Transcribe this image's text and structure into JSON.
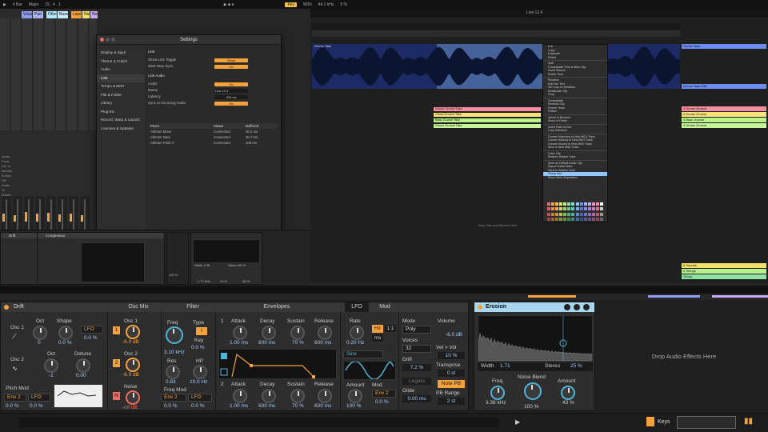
{
  "topbar": {
    "tempo": "4 Bar",
    "scale": "Major",
    "position": "15 . 4 . 1",
    "key_label": "Key",
    "midi_label": "MIDI",
    "sample_rate": "44.1 kHz",
    "cpu": "5 %"
  },
  "session": {
    "tracks": [
      {
        "name": "Vocal",
        "color": "#8f9cf2"
      },
      {
        "name": "Pad",
        "color": "#a9b2f5"
      },
      {
        "name": "Other",
        "color": "#b3e7ff"
      },
      {
        "name": "Bass",
        "color": "#c9ecff"
      },
      {
        "name": "Layers",
        "color": "#f6a23c"
      },
      {
        "name": "Note 1",
        "color": "#f2e16a"
      },
      {
        "name": "Note 2",
        "color": "#c9a8f5"
      }
    ],
    "io_text": [
      "Audio From",
      "Ext. In",
      "1/2",
      "Monitor",
      "In Auto Off",
      "Audio To",
      "Master"
    ]
  },
  "settings": {
    "title": "Settings",
    "nav": [
      {
        "label": "Display & Input",
        "active": false
      },
      {
        "label": "Theme & Colors",
        "active": false
      },
      {
        "label": "Audio",
        "active": false
      },
      {
        "label": "Link",
        "active": true
      },
      {
        "label": "Tempo & MIDI",
        "active": false
      },
      {
        "label": "File & Folder",
        "active": false
      },
      {
        "label": "Library",
        "active": false
      },
      {
        "label": "Plug-Ins",
        "active": false
      },
      {
        "label": "Record, Warp & Launch",
        "active": false
      },
      {
        "label": "Licenses & Updates",
        "active": false
      }
    ],
    "section_link": "Link",
    "show_link_toggle_label": "Show Link Toggle",
    "show_link_toggle_value": "Show",
    "start_stop_sync_label": "Start Stop Sync",
    "start_stop_sync_value": "On",
    "section_link_audio": "Link Audio",
    "audio_label": "Audio",
    "audio_value": "On",
    "name_label": "Name",
    "name_value": "Live 12.4",
    "latency_label": "Latency",
    "latency_value": "200 ms",
    "sync_label": "Sync to Incoming Audio",
    "sync_value": "On",
    "peers_headers": [
      "Peers",
      "Status",
      "Buffered"
    ],
    "peers": [
      {
        "name": "Ableton Move",
        "status": "Connected",
        "buffered": "30.2 ms"
      },
      {
        "name": "Ableton Note",
        "status": "Connected",
        "buffered": "30.7 ms"
      },
      {
        "name": "Ableton Push 3",
        "status": "Connected",
        "buffered": "109 ms"
      }
    ]
  },
  "arrangement": {
    "title": "Live 12.4",
    "ruler_ticks": [
      "65.1",
      "68.1",
      "72.1",
      "76.1",
      "80.1",
      "84.1",
      "88.1",
      "92.1",
      "96.1",
      "100.1",
      "104.1",
      "108.1",
      "112.1",
      "116.1",
      "120.1"
    ],
    "time_ticks": [
      "0:00",
      "0:10",
      "0:20",
      "0:30",
      "0:40",
      "0:50",
      "1:00",
      "1:10",
      "1:20",
      "1:30"
    ],
    "audio_clip_name": "Drums Take",
    "tracks_right": [
      {
        "name": "Drums Take",
        "color": "#6c8cf0"
      },
      {
        "name": "Drums Take Edit",
        "color": "#6c8cf0"
      },
      {
        "name": "1 Drums Groove",
        "color": "#f58fa0"
      },
      {
        "name": "2 Drums Groove",
        "color": "#f9e27a"
      },
      {
        "name": "3 Bass Groove",
        "color": "#b9f28a"
      },
      {
        "name": "4 Drums Groove",
        "color": "#c7f59a"
      }
    ],
    "small_clips": [
      {
        "name": "Drums Groove Take",
        "color": "#f58fa0"
      },
      {
        "name": "Chord Groove Take",
        "color": "#f9e27a"
      },
      {
        "name": "Bass Groove Take",
        "color": "#b9f28a"
      },
      {
        "name": "Drums Groove Take",
        "color": "#c7f59a"
      }
    ],
    "bottom_tracks": [
      {
        "name": "5 Sounds",
        "color": "#f2e16a"
      },
      {
        "name": "6 Strings",
        "color": "#b9f28a"
      },
      {
        "name": "Group",
        "color": "#8fe0a3"
      }
    ],
    "drop_hint": "Drop Files and Devices Here",
    "context_menu": [
      "Cut",
      "Copy",
      "Duplicate",
      "Delete",
      "-",
      "Split",
      "Consolidate Time to New Clip",
      "Insert Silence",
      "Delete Time",
      "-",
      "Rename",
      "Edit Info Text",
      "Set Loop to Selection",
      "Deactivate Clip",
      "Crop",
      "-",
      "Consolidate",
      "Reverse Clip",
      "Freeze Track",
      "Flatten",
      "-",
      "Select in Browser",
      "Show in Finder",
      "-",
      "Insert Fade In/Out",
      "Loop Selection",
      "-",
      "Convert Harmony to New MIDI Track",
      "Convert Melody to New MIDI Track",
      "Convert Drums to New MIDI Track",
      "Slice to New MIDI Track",
      "-",
      "Color Clip",
      "Restore Default Color",
      "-",
      "Save as Default Audio Clip",
      "Export Audio/Video",
      "Send to Ableton Note",
      "Group Into",
      "Show Stem Separation"
    ],
    "context_menu_highlight_index": 38,
    "palette_colors": [
      "#ef6b6b",
      "#f5a35a",
      "#f2c14e",
      "#f2e16a",
      "#b9f28a",
      "#8fe0a3",
      "#7fe0d6",
      "#8fc6ff",
      "#6c8cf0",
      "#a9b2f5",
      "#c9a8f5",
      "#f58fcf",
      "#f58fa0",
      "#ffffff",
      "#e86060",
      "#ef8f4f",
      "#e0b050",
      "#d9d56a",
      "#9fd86f",
      "#6fcf8f",
      "#5fcfc6",
      "#6fb0f0",
      "#5a78e0",
      "#8a90e0",
      "#aa88e0",
      "#d97ac0",
      "#d97a8a",
      "#cccccc",
      "#c95050",
      "#cf7a3a",
      "#c09a3a",
      "#bfbb55",
      "#7fbf55",
      "#55b070",
      "#4ab0a8",
      "#5590d0",
      "#4860c0",
      "#6f70c0",
      "#8a6fc0",
      "#b860a0",
      "#b86070",
      "#999999",
      "#a04040",
      "#a06030",
      "#907830",
      "#909040",
      "#609040",
      "#408850",
      "#3a8a88",
      "#4070a0",
      "#3a4a90",
      "#555a90",
      "#6a5090",
      "#904880",
      "#904858",
      "#666666"
    ]
  },
  "mini_devices": {
    "compressor_title": "Compressor",
    "drift_strip_title": "Drift",
    "width_label": "Width",
    "width_value": "4.38",
    "stereo_label": "Stereo",
    "stereo_value": "85 %",
    "freq_value": "1.77 kHz",
    "noise_blend_value": "70 %",
    "amount_value": "45 %",
    "dry_wet_label": "Dry/Wet",
    "dry_wet_value": "100 %"
  },
  "drift": {
    "title": "Drift",
    "osc_mix_title": "Osc Mix",
    "filter_title": "Filter",
    "envelopes_title": "Envelopes",
    "lfo_tab": "LFO",
    "mod_tab": "Mod",
    "osc1": {
      "label": "Osc 1",
      "oct_label": "Oct",
      "oct_value": "0",
      "shape_label": "Shape",
      "shape_value": "0.0 %",
      "shape_mod": "LFO",
      "shape_mod_amount": "0.0 %"
    },
    "osc2": {
      "label": "Osc 2",
      "oct_label": "Oct",
      "oct_value": "-1",
      "detune_label": "Detune",
      "detune_value": "0.00"
    },
    "mix": {
      "osc1_label": "Osc 1",
      "osc1_value": "-6.0 dB",
      "osc2_label": "Osc 2",
      "osc2_value": "-6.0 dB",
      "noise_label": "Noise",
      "noise_value": "-inf dB",
      "btn1": "1",
      "btn2": "2",
      "btn_n": "N"
    },
    "pitch_mod": {
      "label": "Pitch Mod",
      "src1": "Env 2",
      "src2": "LFO",
      "amt1": "0.0 %",
      "amt2": "0.0 %"
    },
    "filter": {
      "freq_label": "Freq",
      "freq_value": "3.10 kHz",
      "type_label": "Type",
      "type_value": "I",
      "key_label": "Key",
      "key_value": "0.0 %",
      "res_label": "Res",
      "res_value": "0.83",
      "hp_label": "HP",
      "hp_value": "10.0 Hz",
      "freq_mod_label": "Freq Mod",
      "mod_src1": "Env 2",
      "mod_src2": "LFO",
      "mod_amt1": "0.0 %",
      "mod_amt2": "0.0 %"
    },
    "env1": {
      "num": "1",
      "attack_label": "Attack",
      "attack": "1.00 ms",
      "decay_label": "Decay",
      "decay": "600 ms",
      "sustain_label": "Sustain",
      "sustain": "70 %",
      "release_label": "Release",
      "release": "600 ms"
    },
    "env2": {
      "num": "2",
      "attack_label": "Attack",
      "attack": "1.00 ms",
      "decay_label": "Decay",
      "decay": "600 ms",
      "sustain_label": "Sustain",
      "sustain": "70 %",
      "release_label": "Release",
      "release": "600 ms"
    },
    "lfo": {
      "rate_label": "Rate",
      "rate_value": "0.20 Hz",
      "hz_btn": "Hz",
      "ratio_btn": "1:1",
      "ms_btn": "ms",
      "shape": "Sine",
      "amount_label": "Amount",
      "amount_value": "100 %",
      "mod_label": "Mod",
      "mod_src": "Env 2",
      "mod_amt": "0.0 %"
    },
    "global": {
      "mode_label": "Mode",
      "mode_value": "Poly",
      "voices_label": "Voices",
      "voices_value": "32",
      "drift_label": "Drift",
      "drift_value": "7.2 %",
      "legato": "Legato",
      "glide_label": "Glide",
      "glide_value": "0.00 ms",
      "volume_label": "Volume",
      "volume_value": "-6.0 dB",
      "vel_vol_label": "Vel > Vol",
      "vel_vol_value": "10 %",
      "transpose_label": "Transpose",
      "transpose_value": "0 st",
      "note_pb": "Note PB",
      "pb_range_label": "PB Range",
      "pb_range_value": "2 st"
    }
  },
  "erosion": {
    "title": "Erosion",
    "width_label": "Width",
    "width_value": "1.71",
    "stereo_label": "Stereo",
    "stereo_value": "25 %",
    "freq_label": "Freq",
    "freq_value": "3.38 kHz",
    "noise_blend_label": "Noise Blend",
    "noise_blend_value": "100 %",
    "amount_label": "Amount",
    "amount_value": "43 %"
  },
  "drop_fx": "Drop Audio Effects Here",
  "bottom": {
    "keys_label": "Keys"
  },
  "colors": {
    "accent": "#f6a23c",
    "value_blue": "#9cc9ff",
    "device_bg": "#2d2d2d",
    "erosion_header": "#a8d8f0"
  }
}
